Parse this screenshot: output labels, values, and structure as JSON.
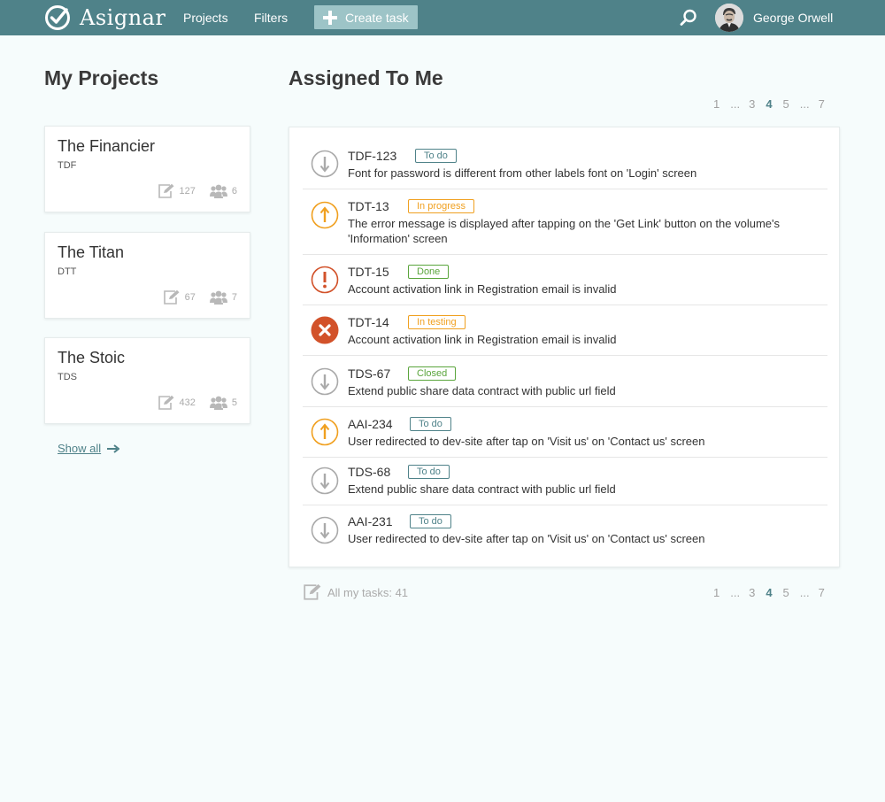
{
  "app": {
    "name": "Asignar",
    "nav": [
      "Projects",
      "Filters"
    ],
    "create_label": "Create task",
    "user_name": "George Orwell",
    "accent": "#4f8289"
  },
  "projects": {
    "title": "My Projects",
    "items": [
      {
        "name": "The Financier",
        "code": "TDF",
        "tasks": "127",
        "members": "6"
      },
      {
        "name": "The Titan",
        "code": "DTT",
        "tasks": "67",
        "members": "7"
      },
      {
        "name": "The Stoic",
        "code": "TDS",
        "tasks": "432",
        "members": "5"
      }
    ],
    "show_all": "Show all"
  },
  "assigned": {
    "title": "Assigned To Me",
    "pagination": [
      "1",
      "...",
      "3",
      "4",
      "5",
      "...",
      "7"
    ],
    "current_page": "4",
    "total_label": "All my tasks: 41",
    "tasks": [
      {
        "id": "TDF-123",
        "status": "To do",
        "priority": "low",
        "desc": "Font for password is different from other labels font on 'Login' screen"
      },
      {
        "id": "TDT-13",
        "status": "In progress",
        "priority": "high",
        "desc": "The error message is displayed after tapping on the 'Get Link' button on the volume's 'Information' screen"
      },
      {
        "id": "TDT-15",
        "status": "Done",
        "priority": "critical",
        "desc": "Account activation link in Registration email is invalid"
      },
      {
        "id": "TDT-14",
        "status": "In testing",
        "priority": "blocker",
        "desc": "Account activation link in Registration email is invalid"
      },
      {
        "id": "TDS-67",
        "status": "Closed",
        "priority": "low",
        "desc": "Extend public share data contract with public url field"
      },
      {
        "id": "AAI-234",
        "status": "To do",
        "priority": "high",
        "desc": "User redirected to dev-site after tap on 'Visit us' on 'Contact us' screen"
      },
      {
        "id": "TDS-68",
        "status": "To do",
        "priority": "low",
        "desc": "Extend public share data contract with public url field"
      },
      {
        "id": "AAI-231",
        "status": "To do",
        "priority": "low",
        "desc": "User redirected to dev-site after tap on 'Visit us' on 'Contact us' screen"
      }
    ]
  },
  "icons": {
    "logo": "checkmark-circle-icon",
    "search": "search-icon",
    "create": "plus-icon",
    "tasks": "edit-icon",
    "members": "users-icon",
    "arrow": "arrow-right-icon",
    "priority_low": "arrow-down-circle-icon",
    "priority_high": "arrow-up-circle-icon",
    "priority_critical": "exclamation-circle-icon",
    "priority_blocker": "close-circle-icon"
  },
  "colors": {
    "topbar": "#4f8289",
    "todo": "#4f8289",
    "in_progress": "#f0a020",
    "done": "#5aa53c",
    "critical": "#d2522a",
    "low": "#aaaaaa"
  }
}
